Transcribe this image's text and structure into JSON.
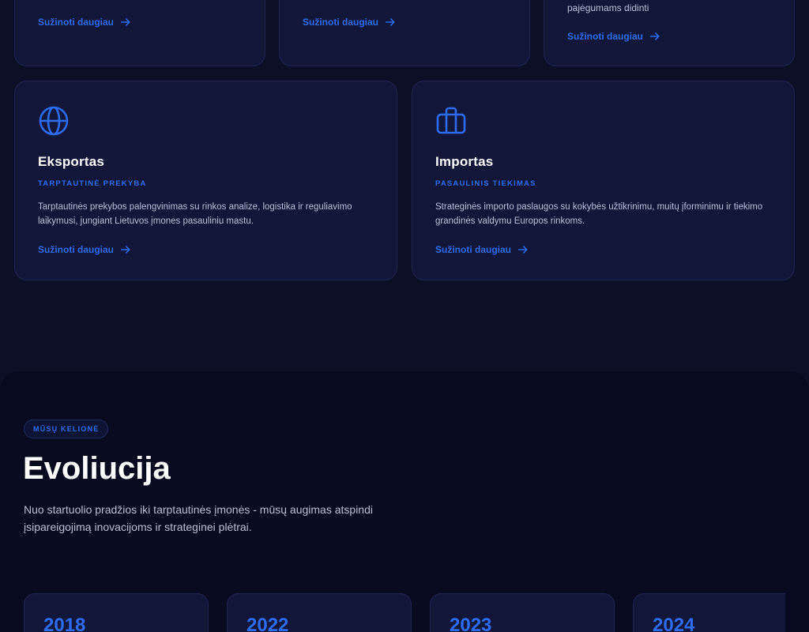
{
  "top_cards": [
    {
      "link": "Sužinoti daugiau"
    },
    {
      "link": "Sužinoti daugiau"
    },
    {
      "text": "pajėgumams didinti",
      "link": "Sužinoti daugiau"
    }
  ],
  "services": [
    {
      "icon": "globe-icon",
      "title": "Eksportas",
      "subtitle": "TARPTAUTINĖ PREKYBA",
      "description": "Tarptautinės prekybos palengvinimas su rinkos analize, logistika ir reguliavimo laikymusi, jungiant Lietuvos įmones pasauliniu mastu.",
      "link": "Sužinoti daugiau"
    },
    {
      "icon": "containers-icon",
      "title": "Importas",
      "subtitle": "PASAULINIS TIEKIMAS",
      "description": "Strateginės importo paslaugos su kokybės užtikrinimu, muitų įforminimu ir tiekimo grandinės valdymu Europos rinkoms.",
      "link": "Sužinoti daugiau"
    }
  ],
  "evolution": {
    "badge": "MŪSŲ KELIONĖ",
    "title": "Evoliucija",
    "description": "Nuo startuolio pradžios iki tarptautinės įmonės - mūsų augimas atspindi įsipareigojimą inovacijoms ir strateginei plėtrai.",
    "years": [
      "2018",
      "2022",
      "2023",
      "2024"
    ]
  },
  "colors": {
    "background": "#0b1027",
    "card": "#12173a",
    "accent": "#2d6cf2"
  }
}
